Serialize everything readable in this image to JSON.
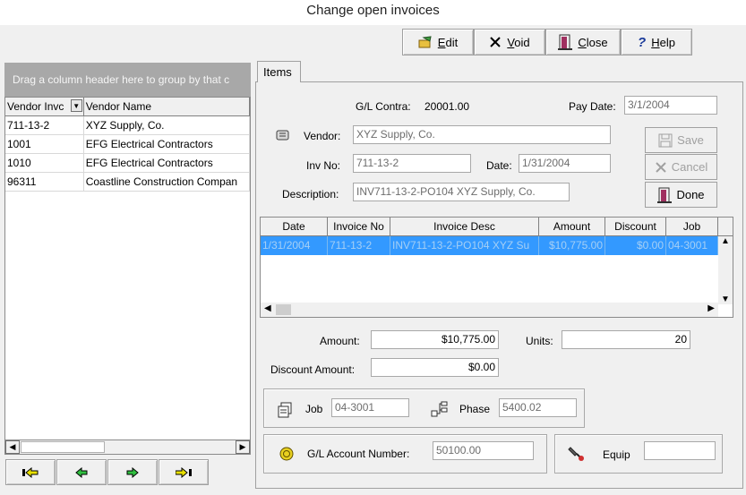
{
  "window": {
    "title": "Change open invoices"
  },
  "toolbar": {
    "edit_label": "Edit",
    "void_label": "Void",
    "close_label": "Close",
    "help_label": "Help"
  },
  "group_panel": {
    "text": "Drag a column header here to group by that c"
  },
  "vendor_grid": {
    "columns": [
      "Vendor Invc",
      "Vendor Name"
    ],
    "rows": [
      [
        "711-13-2",
        "XYZ Supply, Co."
      ],
      [
        "1001",
        "EFG Electrical Contractors"
      ],
      [
        "1010",
        "EFG Electrical Contractors"
      ],
      [
        "96311",
        "Coastline Construction Compan"
      ]
    ]
  },
  "tabs": {
    "items": "Items"
  },
  "form": {
    "gl_contra_label": "G/L Contra:",
    "gl_contra_value": "20001.00",
    "pay_date_label": "Pay Date:",
    "pay_date_value": "3/1/2004",
    "vendor_label": "Vendor:",
    "vendor_value": "XYZ Supply, Co.",
    "inv_no_label": "Inv No:",
    "inv_no_value": "711-13-2",
    "date_label": "Date:",
    "date_value": "1/31/2004",
    "description_label": "Description:",
    "description_value": "INV711-13-2-PO104 XYZ Supply, Co.",
    "save_label": "Save",
    "cancel_label": "Cancel",
    "done_label": "Done"
  },
  "items_grid": {
    "columns": [
      "Date",
      "Invoice No",
      "Invoice Desc",
      "Amount",
      "Discount",
      "Job"
    ],
    "rows": [
      [
        "1/31/2004",
        "711-13-2",
        "INV711-13-2-PO104 XYZ Su",
        "$10,775.00",
        "$0.00",
        "04-3001"
      ]
    ]
  },
  "totals": {
    "amount_label": "Amount:",
    "amount_value": "$10,775.00",
    "units_label": "Units:",
    "units_value": "20",
    "discount_label": "Discount Amount:",
    "discount_value": "$0.00"
  },
  "job_group": {
    "job_label": "Job",
    "job_value": "04-3001",
    "phase_label": "Phase",
    "phase_value": "5400.02"
  },
  "gl_group": {
    "label": "G/L Account Number:",
    "value": "50100.00"
  },
  "equip_group": {
    "label": "Equip",
    "value": ""
  },
  "colors": {
    "selection": "#3399ff",
    "group_panel": "#a8a8a8",
    "window_bg": "#f0f0f0"
  },
  "icons": [
    "edit-icon",
    "void-icon",
    "close-door-icon",
    "help-icon",
    "save-icon",
    "cancel-icon",
    "done-icon",
    "vendor-icon",
    "job-icon",
    "phase-icon",
    "gl-account-icon",
    "equip-icon",
    "first-record-icon",
    "prev-record-icon",
    "next-record-icon",
    "last-record-icon"
  ]
}
